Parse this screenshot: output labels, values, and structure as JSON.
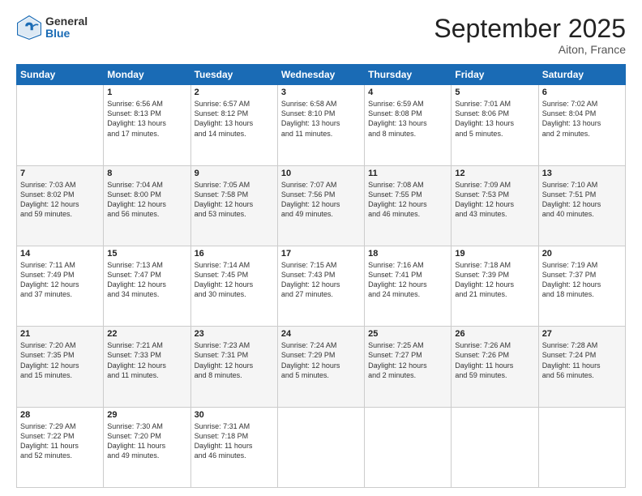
{
  "logo": {
    "general": "General",
    "blue": "Blue"
  },
  "header": {
    "month": "September 2025",
    "location": "Aiton, France"
  },
  "weekdays": [
    "Sunday",
    "Monday",
    "Tuesday",
    "Wednesday",
    "Thursday",
    "Friday",
    "Saturday"
  ],
  "rows": [
    [
      {
        "day": "",
        "text": ""
      },
      {
        "day": "1",
        "text": "Sunrise: 6:56 AM\nSunset: 8:13 PM\nDaylight: 13 hours\nand 17 minutes."
      },
      {
        "day": "2",
        "text": "Sunrise: 6:57 AM\nSunset: 8:12 PM\nDaylight: 13 hours\nand 14 minutes."
      },
      {
        "day": "3",
        "text": "Sunrise: 6:58 AM\nSunset: 8:10 PM\nDaylight: 13 hours\nand 11 minutes."
      },
      {
        "day": "4",
        "text": "Sunrise: 6:59 AM\nSunset: 8:08 PM\nDaylight: 13 hours\nand 8 minutes."
      },
      {
        "day": "5",
        "text": "Sunrise: 7:01 AM\nSunset: 8:06 PM\nDaylight: 13 hours\nand 5 minutes."
      },
      {
        "day": "6",
        "text": "Sunrise: 7:02 AM\nSunset: 8:04 PM\nDaylight: 13 hours\nand 2 minutes."
      }
    ],
    [
      {
        "day": "7",
        "text": "Sunrise: 7:03 AM\nSunset: 8:02 PM\nDaylight: 12 hours\nand 59 minutes."
      },
      {
        "day": "8",
        "text": "Sunrise: 7:04 AM\nSunset: 8:00 PM\nDaylight: 12 hours\nand 56 minutes."
      },
      {
        "day": "9",
        "text": "Sunrise: 7:05 AM\nSunset: 7:58 PM\nDaylight: 12 hours\nand 53 minutes."
      },
      {
        "day": "10",
        "text": "Sunrise: 7:07 AM\nSunset: 7:56 PM\nDaylight: 12 hours\nand 49 minutes."
      },
      {
        "day": "11",
        "text": "Sunrise: 7:08 AM\nSunset: 7:55 PM\nDaylight: 12 hours\nand 46 minutes."
      },
      {
        "day": "12",
        "text": "Sunrise: 7:09 AM\nSunset: 7:53 PM\nDaylight: 12 hours\nand 43 minutes."
      },
      {
        "day": "13",
        "text": "Sunrise: 7:10 AM\nSunset: 7:51 PM\nDaylight: 12 hours\nand 40 minutes."
      }
    ],
    [
      {
        "day": "14",
        "text": "Sunrise: 7:11 AM\nSunset: 7:49 PM\nDaylight: 12 hours\nand 37 minutes."
      },
      {
        "day": "15",
        "text": "Sunrise: 7:13 AM\nSunset: 7:47 PM\nDaylight: 12 hours\nand 34 minutes."
      },
      {
        "day": "16",
        "text": "Sunrise: 7:14 AM\nSunset: 7:45 PM\nDaylight: 12 hours\nand 30 minutes."
      },
      {
        "day": "17",
        "text": "Sunrise: 7:15 AM\nSunset: 7:43 PM\nDaylight: 12 hours\nand 27 minutes."
      },
      {
        "day": "18",
        "text": "Sunrise: 7:16 AM\nSunset: 7:41 PM\nDaylight: 12 hours\nand 24 minutes."
      },
      {
        "day": "19",
        "text": "Sunrise: 7:18 AM\nSunset: 7:39 PM\nDaylight: 12 hours\nand 21 minutes."
      },
      {
        "day": "20",
        "text": "Sunrise: 7:19 AM\nSunset: 7:37 PM\nDaylight: 12 hours\nand 18 minutes."
      }
    ],
    [
      {
        "day": "21",
        "text": "Sunrise: 7:20 AM\nSunset: 7:35 PM\nDaylight: 12 hours\nand 15 minutes."
      },
      {
        "day": "22",
        "text": "Sunrise: 7:21 AM\nSunset: 7:33 PM\nDaylight: 12 hours\nand 11 minutes."
      },
      {
        "day": "23",
        "text": "Sunrise: 7:23 AM\nSunset: 7:31 PM\nDaylight: 12 hours\nand 8 minutes."
      },
      {
        "day": "24",
        "text": "Sunrise: 7:24 AM\nSunset: 7:29 PM\nDaylight: 12 hours\nand 5 minutes."
      },
      {
        "day": "25",
        "text": "Sunrise: 7:25 AM\nSunset: 7:27 PM\nDaylight: 12 hours\nand 2 minutes."
      },
      {
        "day": "26",
        "text": "Sunrise: 7:26 AM\nSunset: 7:26 PM\nDaylight: 11 hours\nand 59 minutes."
      },
      {
        "day": "27",
        "text": "Sunrise: 7:28 AM\nSunset: 7:24 PM\nDaylight: 11 hours\nand 56 minutes."
      }
    ],
    [
      {
        "day": "28",
        "text": "Sunrise: 7:29 AM\nSunset: 7:22 PM\nDaylight: 11 hours\nand 52 minutes."
      },
      {
        "day": "29",
        "text": "Sunrise: 7:30 AM\nSunset: 7:20 PM\nDaylight: 11 hours\nand 49 minutes."
      },
      {
        "day": "30",
        "text": "Sunrise: 7:31 AM\nSunset: 7:18 PM\nDaylight: 11 hours\nand 46 minutes."
      },
      {
        "day": "",
        "text": ""
      },
      {
        "day": "",
        "text": ""
      },
      {
        "day": "",
        "text": ""
      },
      {
        "day": "",
        "text": ""
      }
    ]
  ]
}
